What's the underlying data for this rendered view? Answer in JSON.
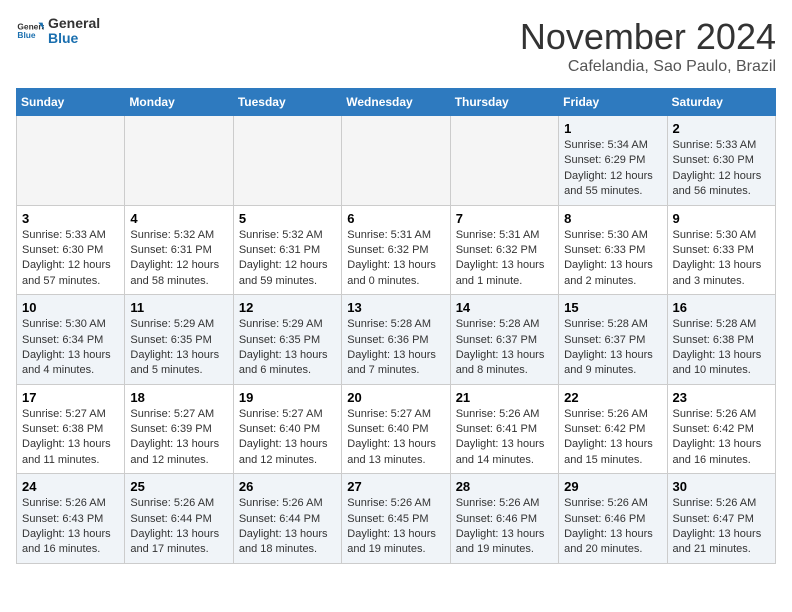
{
  "logo": {
    "general": "General",
    "blue": "Blue"
  },
  "header": {
    "month": "November 2024",
    "location": "Cafelandia, Sao Paulo, Brazil"
  },
  "days_of_week": [
    "Sunday",
    "Monday",
    "Tuesday",
    "Wednesday",
    "Thursday",
    "Friday",
    "Saturday"
  ],
  "weeks": [
    [
      {
        "day": "",
        "info": ""
      },
      {
        "day": "",
        "info": ""
      },
      {
        "day": "",
        "info": ""
      },
      {
        "day": "",
        "info": ""
      },
      {
        "day": "",
        "info": ""
      },
      {
        "day": "1",
        "info": "Sunrise: 5:34 AM\nSunset: 6:29 PM\nDaylight: 12 hours and 55 minutes."
      },
      {
        "day": "2",
        "info": "Sunrise: 5:33 AM\nSunset: 6:30 PM\nDaylight: 12 hours and 56 minutes."
      }
    ],
    [
      {
        "day": "3",
        "info": "Sunrise: 5:33 AM\nSunset: 6:30 PM\nDaylight: 12 hours and 57 minutes."
      },
      {
        "day": "4",
        "info": "Sunrise: 5:32 AM\nSunset: 6:31 PM\nDaylight: 12 hours and 58 minutes."
      },
      {
        "day": "5",
        "info": "Sunrise: 5:32 AM\nSunset: 6:31 PM\nDaylight: 12 hours and 59 minutes."
      },
      {
        "day": "6",
        "info": "Sunrise: 5:31 AM\nSunset: 6:32 PM\nDaylight: 13 hours and 0 minutes."
      },
      {
        "day": "7",
        "info": "Sunrise: 5:31 AM\nSunset: 6:32 PM\nDaylight: 13 hours and 1 minute."
      },
      {
        "day": "8",
        "info": "Sunrise: 5:30 AM\nSunset: 6:33 PM\nDaylight: 13 hours and 2 minutes."
      },
      {
        "day": "9",
        "info": "Sunrise: 5:30 AM\nSunset: 6:33 PM\nDaylight: 13 hours and 3 minutes."
      }
    ],
    [
      {
        "day": "10",
        "info": "Sunrise: 5:30 AM\nSunset: 6:34 PM\nDaylight: 13 hours and 4 minutes."
      },
      {
        "day": "11",
        "info": "Sunrise: 5:29 AM\nSunset: 6:35 PM\nDaylight: 13 hours and 5 minutes."
      },
      {
        "day": "12",
        "info": "Sunrise: 5:29 AM\nSunset: 6:35 PM\nDaylight: 13 hours and 6 minutes."
      },
      {
        "day": "13",
        "info": "Sunrise: 5:28 AM\nSunset: 6:36 PM\nDaylight: 13 hours and 7 minutes."
      },
      {
        "day": "14",
        "info": "Sunrise: 5:28 AM\nSunset: 6:37 PM\nDaylight: 13 hours and 8 minutes."
      },
      {
        "day": "15",
        "info": "Sunrise: 5:28 AM\nSunset: 6:37 PM\nDaylight: 13 hours and 9 minutes."
      },
      {
        "day": "16",
        "info": "Sunrise: 5:28 AM\nSunset: 6:38 PM\nDaylight: 13 hours and 10 minutes."
      }
    ],
    [
      {
        "day": "17",
        "info": "Sunrise: 5:27 AM\nSunset: 6:38 PM\nDaylight: 13 hours and 11 minutes."
      },
      {
        "day": "18",
        "info": "Sunrise: 5:27 AM\nSunset: 6:39 PM\nDaylight: 13 hours and 12 minutes."
      },
      {
        "day": "19",
        "info": "Sunrise: 5:27 AM\nSunset: 6:40 PM\nDaylight: 13 hours and 12 minutes."
      },
      {
        "day": "20",
        "info": "Sunrise: 5:27 AM\nSunset: 6:40 PM\nDaylight: 13 hours and 13 minutes."
      },
      {
        "day": "21",
        "info": "Sunrise: 5:26 AM\nSunset: 6:41 PM\nDaylight: 13 hours and 14 minutes."
      },
      {
        "day": "22",
        "info": "Sunrise: 5:26 AM\nSunset: 6:42 PM\nDaylight: 13 hours and 15 minutes."
      },
      {
        "day": "23",
        "info": "Sunrise: 5:26 AM\nSunset: 6:42 PM\nDaylight: 13 hours and 16 minutes."
      }
    ],
    [
      {
        "day": "24",
        "info": "Sunrise: 5:26 AM\nSunset: 6:43 PM\nDaylight: 13 hours and 16 minutes."
      },
      {
        "day": "25",
        "info": "Sunrise: 5:26 AM\nSunset: 6:44 PM\nDaylight: 13 hours and 17 minutes."
      },
      {
        "day": "26",
        "info": "Sunrise: 5:26 AM\nSunset: 6:44 PM\nDaylight: 13 hours and 18 minutes."
      },
      {
        "day": "27",
        "info": "Sunrise: 5:26 AM\nSunset: 6:45 PM\nDaylight: 13 hours and 19 minutes."
      },
      {
        "day": "28",
        "info": "Sunrise: 5:26 AM\nSunset: 6:46 PM\nDaylight: 13 hours and 19 minutes."
      },
      {
        "day": "29",
        "info": "Sunrise: 5:26 AM\nSunset: 6:46 PM\nDaylight: 13 hours and 20 minutes."
      },
      {
        "day": "30",
        "info": "Sunrise: 5:26 AM\nSunset: 6:47 PM\nDaylight: 13 hours and 21 minutes."
      }
    ]
  ]
}
